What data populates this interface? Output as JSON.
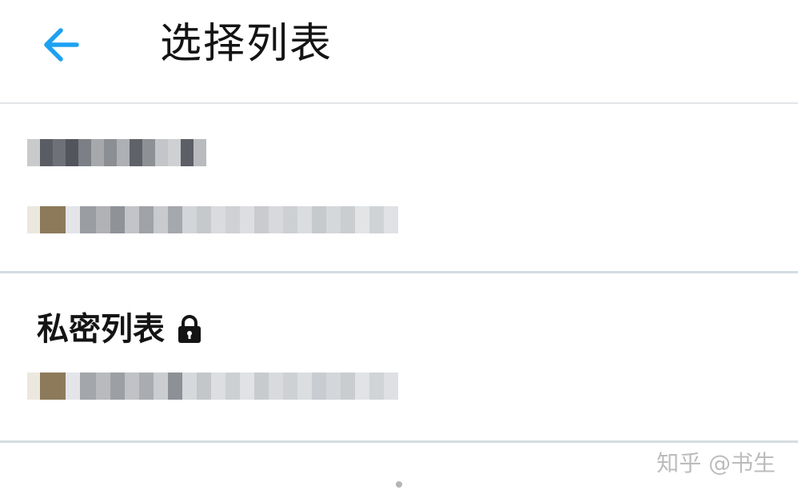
{
  "header": {
    "title": "选择列表",
    "back_icon": "arrow-left-icon",
    "accent_color": "#1da1f2"
  },
  "lists": [
    {
      "title_hidden": "[pixelated list name]",
      "subtitle_hidden": "[pixelated owner info]",
      "private": false
    },
    {
      "title": "私密列表",
      "lock_icon": "lock-icon",
      "subtitle_hidden": "[pixelated owner info]",
      "private": true
    }
  ],
  "watermark": {
    "text": "知乎 @书生"
  }
}
